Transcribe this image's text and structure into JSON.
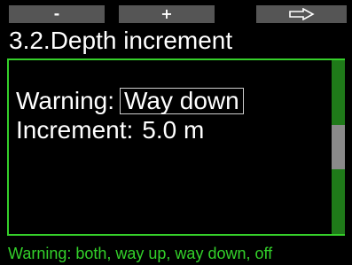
{
  "softkeys": {
    "minus_label": "-",
    "plus_label": "+",
    "next_label": "⇨"
  },
  "screen": {
    "title": "3.2.Depth increment"
  },
  "settings": {
    "warning_label": "Warning:",
    "warning_value": "Way down",
    "increment_label": "Increment:",
    "increment_value": "5.0 m"
  },
  "scroll": {
    "position_fraction": 0.5
  },
  "status": {
    "text": "Warning: both, way up, way down, off"
  },
  "colors": {
    "accent_green": "#35d02a",
    "scrollbar_track": "#1f7a19",
    "scrollbar_thumb": "#8a8a8a",
    "softkey_bg": "#555555"
  }
}
